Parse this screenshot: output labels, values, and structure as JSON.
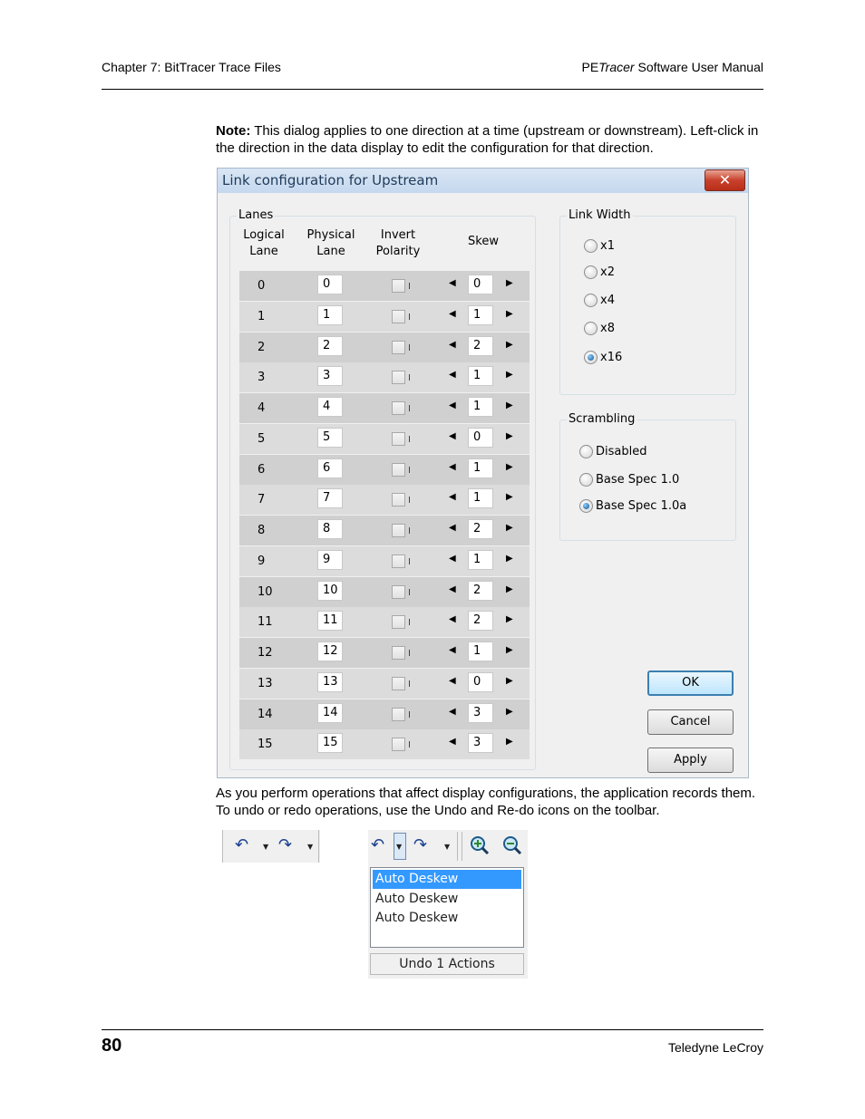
{
  "header": {
    "chapter": "Chapter 7: BitTracer Trace Files",
    "manual_prefix": "PE",
    "manual_italic": "Tracer",
    "manual_suffix": " Software User Manual"
  },
  "note": {
    "label": "Note:",
    "text": " This dialog applies to one direction at a time (upstream or downstream). Left-click in the direction in the data display to edit the configuration for that direction."
  },
  "dialog": {
    "title": "Link configuration for Upstream",
    "close_label": "✕",
    "lanes_group": "Lanes",
    "col_logical": "Logical\nLane",
    "col_physical": "Physical\nLane",
    "col_invert": "Invert\nPolarity",
    "col_skew": "Skew",
    "rows": [
      {
        "logical": "0",
        "physical": "0",
        "skew": "0"
      },
      {
        "logical": "1",
        "physical": "1",
        "skew": "1"
      },
      {
        "logical": "2",
        "physical": "2",
        "skew": "2"
      },
      {
        "logical": "3",
        "physical": "3",
        "skew": "1"
      },
      {
        "logical": "4",
        "physical": "4",
        "skew": "1"
      },
      {
        "logical": "5",
        "physical": "5",
        "skew": "0"
      },
      {
        "logical": "6",
        "physical": "6",
        "skew": "1"
      },
      {
        "logical": "7",
        "physical": "7",
        "skew": "1"
      },
      {
        "logical": "8",
        "physical": "8",
        "skew": "2"
      },
      {
        "logical": "9",
        "physical": "9",
        "skew": "1"
      },
      {
        "logical": "10",
        "physical": "10",
        "skew": "2"
      },
      {
        "logical": "11",
        "physical": "11",
        "skew": "2"
      },
      {
        "logical": "12",
        "physical": "12",
        "skew": "1"
      },
      {
        "logical": "13",
        "physical": "13",
        "skew": "0"
      },
      {
        "logical": "14",
        "physical": "14",
        "skew": "3"
      },
      {
        "logical": "15",
        "physical": "15",
        "skew": "3"
      }
    ],
    "link_width_group": "Link Width",
    "link_width_options": [
      "x1",
      "x2",
      "x4",
      "x8",
      "x16"
    ],
    "link_width_selected": "x16",
    "scrambling_group": "Scrambling",
    "scrambling_options": [
      "Disabled",
      "Base Spec 1.0",
      "Base Spec 1.0a"
    ],
    "scrambling_selected": "Base Spec 1.0a",
    "ok_label": "OK",
    "cancel_label": "Cancel",
    "apply_label": "Apply"
  },
  "body_text": "As you perform operations that affect display configurations, the application records them. To undo or redo operations, use the Undo and Re-do icons on the toolbar.",
  "toolbar": {
    "undo_icon": "undo-icon",
    "redo_icon": "redo-icon",
    "zoom_in_icon": "zoom-in-icon",
    "zoom_out_icon": "zoom-out-icon"
  },
  "undo_list": {
    "items": [
      "Auto Deskew",
      "Auto Deskew",
      "Auto Deskew"
    ],
    "selected_index": 0,
    "status": "Undo 1 Actions"
  },
  "footer": {
    "page_number": "80",
    "company": "Teledyne LeCroy"
  }
}
